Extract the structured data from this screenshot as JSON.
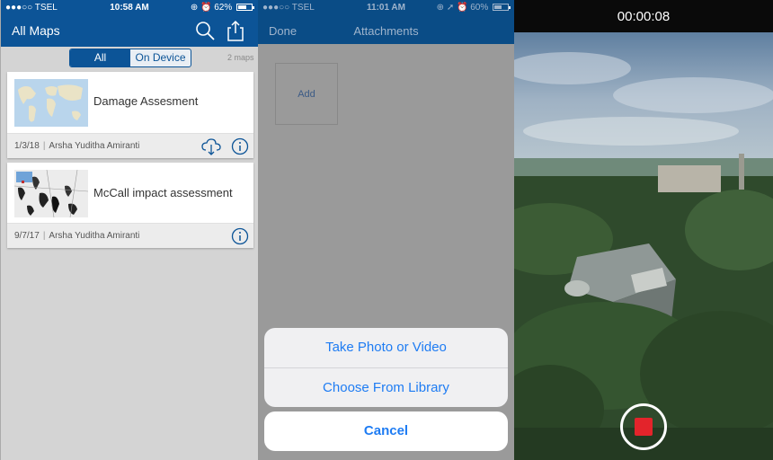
{
  "left_panel": {
    "status_bar": {
      "carrier": "●●●○○ TSEL",
      "time": "10:58 AM",
      "battery": "62%",
      "battery_level": 0.62
    },
    "title": "All Maps",
    "filter": {
      "all": "All",
      "on_device": "On Device",
      "selected": "All"
    },
    "map_count": "2 maps",
    "maps": [
      {
        "name": "Damage Assesment",
        "date": "1/3/18",
        "owner": "Arsha Yuditha Amiranti"
      },
      {
        "name": "McCall impact assessment",
        "date": "9/7/17",
        "owner": "Arsha Yuditha Amiranti"
      }
    ],
    "icons": [
      "search-icon",
      "share-icon",
      "cloud-download-icon",
      "info-icon"
    ],
    "colors": {
      "nav": "#0c5497",
      "accent": "#0c5497"
    }
  },
  "middle_panel": {
    "status_bar": {
      "carrier": "●●●○○ TSEL",
      "time": "11:01 AM",
      "battery": "60%",
      "battery_level": 0.6
    },
    "done": "Done",
    "title": "Attachments",
    "add": "Add",
    "action_sheet": {
      "take_photo": "Take Photo or Video",
      "choose_library": "Choose From Library",
      "cancel": "Cancel"
    },
    "colors": {
      "action": "#1e7cf3"
    }
  },
  "right_panel": {
    "timer": "00:00:08",
    "record_color": "#e3242b"
  }
}
